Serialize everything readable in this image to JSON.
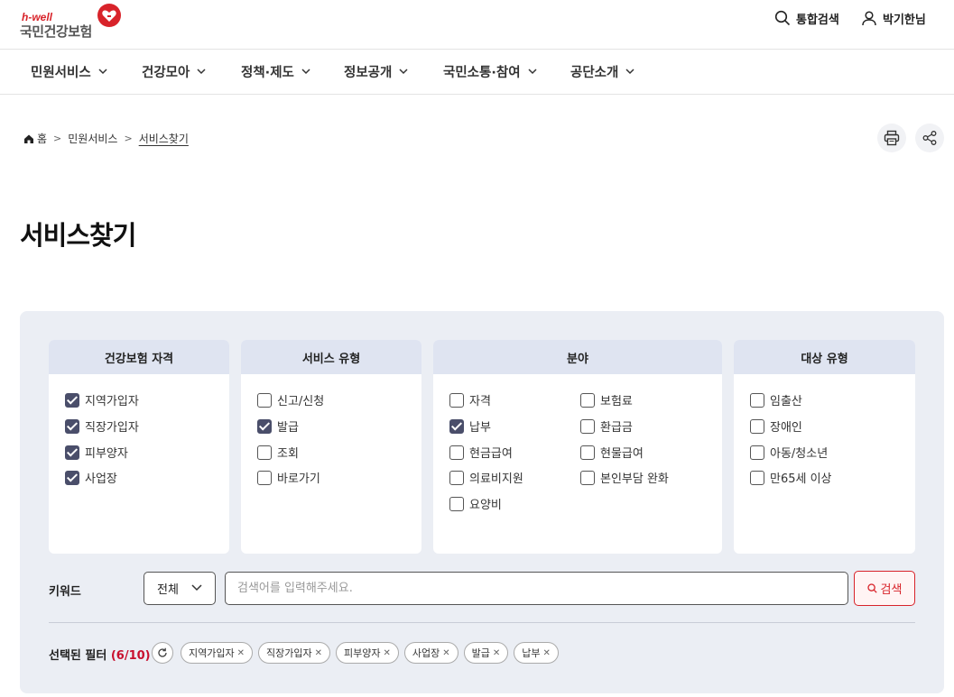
{
  "header": {
    "logo_sub": "h-well",
    "logo_name": "국민건강보험",
    "search_label": "통합검색",
    "user_label": "박기한님"
  },
  "gnb": [
    "민원서비스",
    "건강모아",
    "정책·제도",
    "정보공개",
    "국민소통·참여",
    "공단소개"
  ],
  "breadcrumb": {
    "home": "홈",
    "level1": "민원서비스",
    "current": "서비스찾기"
  },
  "page_title": "서비스찾기",
  "filters": {
    "qualification": {
      "title": "건강보험 자격",
      "options": [
        {
          "label": "지역가입자",
          "checked": true
        },
        {
          "label": "직장가입자",
          "checked": true
        },
        {
          "label": "피부양자",
          "checked": true
        },
        {
          "label": "사업장",
          "checked": true
        }
      ]
    },
    "service_type": {
      "title": "서비스 유형",
      "options": [
        {
          "label": "신고/신청",
          "checked": false
        },
        {
          "label": "발급",
          "checked": true
        },
        {
          "label": "조회",
          "checked": false
        },
        {
          "label": "바로가기",
          "checked": false
        }
      ]
    },
    "field": {
      "title": "분야",
      "options": [
        {
          "label": "자격",
          "checked": false
        },
        {
          "label": "보험료",
          "checked": false
        },
        {
          "label": "납부",
          "checked": true
        },
        {
          "label": "환급금",
          "checked": false
        },
        {
          "label": "현금급여",
          "checked": false
        },
        {
          "label": "현물급여",
          "checked": false
        },
        {
          "label": "의료비지원",
          "checked": false
        },
        {
          "label": "본인부담 완화",
          "checked": false
        },
        {
          "label": "요양비",
          "checked": false
        }
      ]
    },
    "target_type": {
      "title": "대상 유형",
      "options": [
        {
          "label": "임출산",
          "checked": false
        },
        {
          "label": "장애인",
          "checked": false
        },
        {
          "label": "아동/청소년",
          "checked": false
        },
        {
          "label": "만65세 이상",
          "checked": false
        }
      ]
    }
  },
  "keyword": {
    "label": "키워드",
    "scope": "전체",
    "placeholder": "검색어를 입력해주세요.",
    "value": "",
    "button": "검색"
  },
  "selected": {
    "label": "선택된 필터",
    "count": "(6/10)",
    "chips": [
      "지역가입자",
      "직장가입자",
      "피부양자",
      "사업장",
      "발급",
      "납부"
    ]
  },
  "icons": {
    "home": "home-icon",
    "print": "print-icon",
    "share": "share-icon",
    "search": "search-icon",
    "user": "user-icon",
    "reset": "refresh-icon",
    "heart": "heart-logo-icon"
  },
  "colors": {
    "brand_red": "#d8232a",
    "panel_bg": "#ebeef4",
    "card_head": "#dfe4f1",
    "checkbox_on": "#4a4e6a"
  }
}
